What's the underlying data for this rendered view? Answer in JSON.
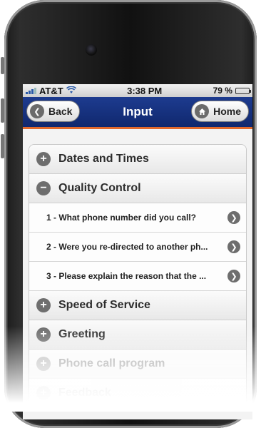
{
  "status_bar": {
    "carrier": "AT&T",
    "time": "3:38 PM",
    "battery": "79 %",
    "battery_level": 0.79
  },
  "nav": {
    "title": "Input",
    "back_label": "Back",
    "home_label": "Home"
  },
  "sections": [
    {
      "label": "Dates and Times",
      "state": "collapsed"
    },
    {
      "label": "Quality Control",
      "state": "expanded",
      "items": [
        {
          "label": "1 - What phone number did you call?"
        },
        {
          "label": "2 - Were you re-directed to another ph..."
        },
        {
          "label": "3 - Please explain the reason that the ..."
        }
      ]
    },
    {
      "label": "Speed of Service",
      "state": "collapsed"
    },
    {
      "label": "Greeting",
      "state": "collapsed"
    },
    {
      "label": "Phone call program",
      "state": "collapsed"
    },
    {
      "label": "Feedback",
      "state": "collapsed"
    }
  ],
  "icons": {
    "back": "chevron-left-icon",
    "home": "home-icon",
    "collapsed": "plus-icon",
    "expanded": "minus-icon",
    "item": "chevron-right-icon"
  },
  "colors": {
    "navbar": "#10286e",
    "accent_line": "#e26a2c",
    "battery_fill": "#4caf2d"
  }
}
